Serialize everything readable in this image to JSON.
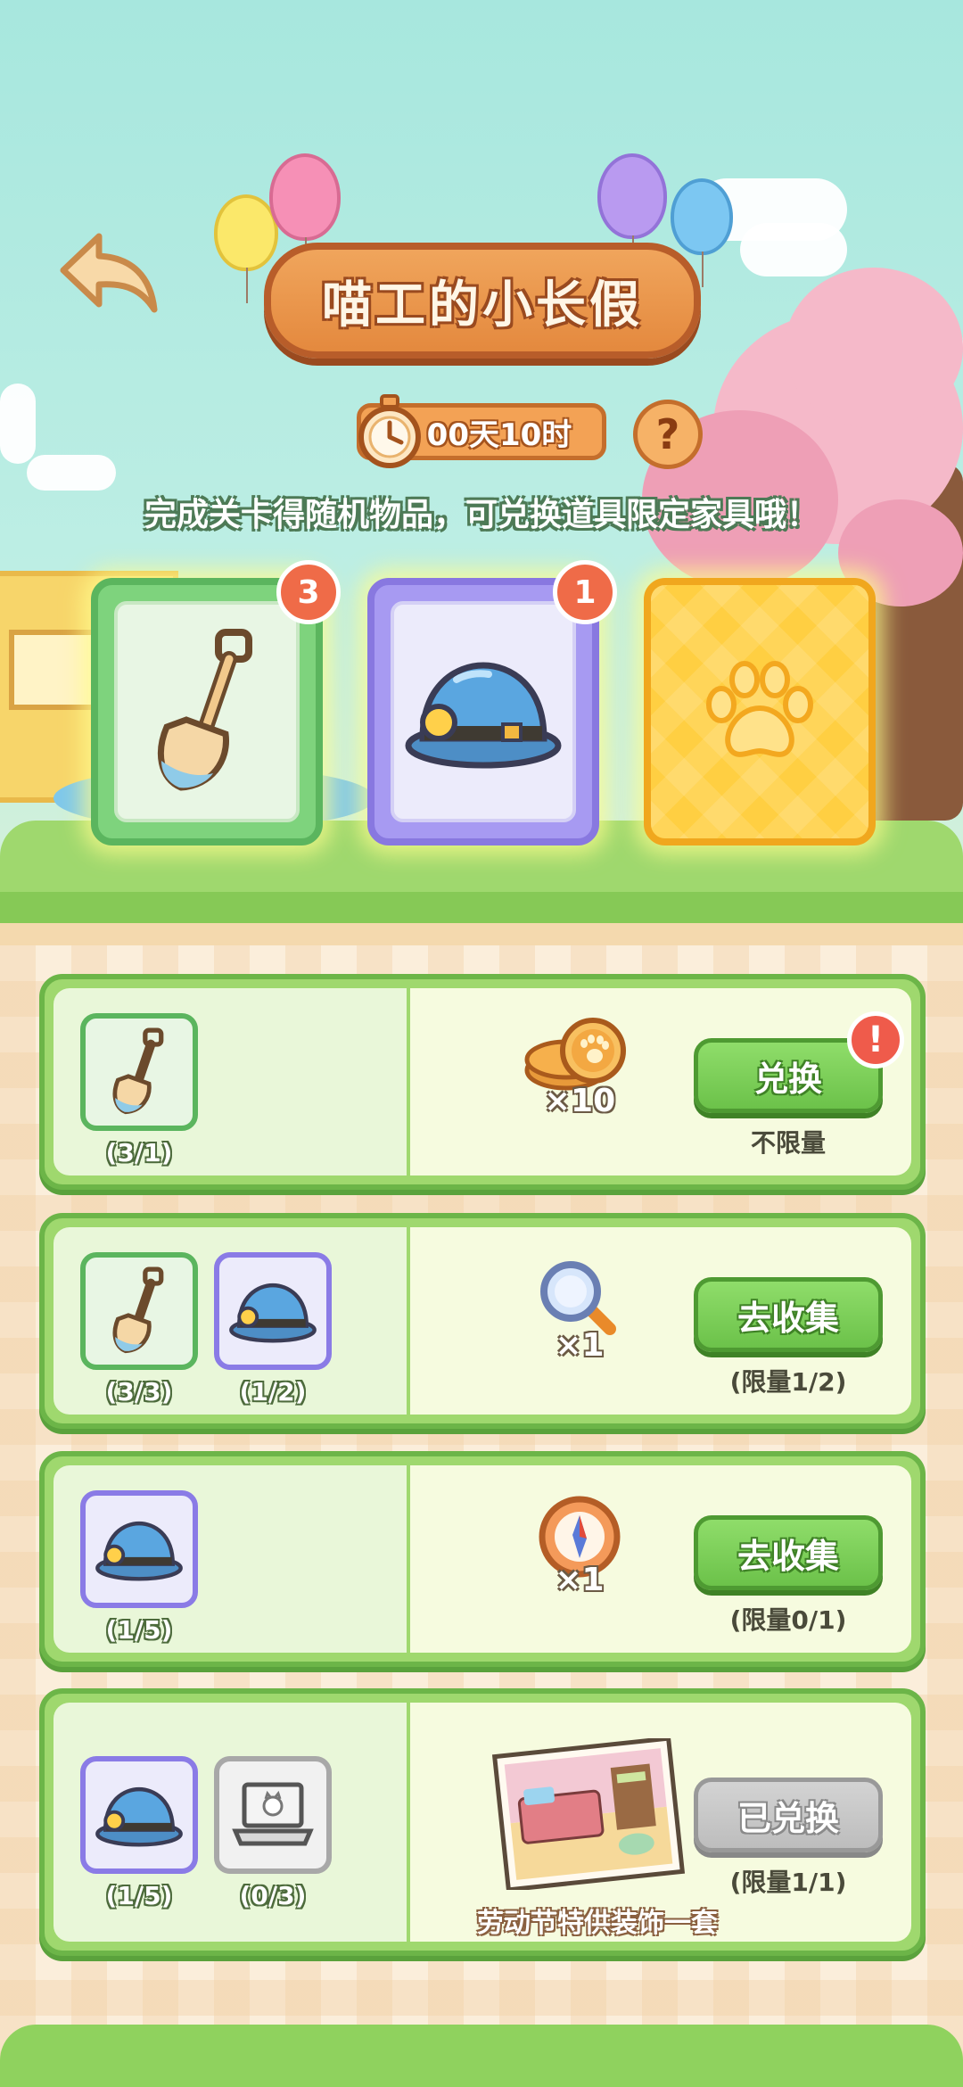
{
  "header": {
    "title": "喵工的小长假",
    "timer": "00天10时",
    "help": "?",
    "subtitle": "完成关卡得随机物品，可兑换道具限定家具哦！"
  },
  "cards": [
    {
      "name": "shovel-card",
      "icon": "shovel-icon",
      "badge": "3",
      "color": "#7ed37d"
    },
    {
      "name": "helmet-card",
      "icon": "mining-helmet-icon",
      "badge": "1",
      "color": "#a79af2"
    },
    {
      "name": "mystery-card",
      "icon": "paw-icon",
      "badge": "",
      "color": "#fcc63a"
    }
  ],
  "rows": [
    {
      "requirements": [
        {
          "icon": "shovel-icon",
          "count": "(3/1)"
        }
      ],
      "reward_icon": "coins-icon",
      "reward_qty": "×10",
      "button": "兑换",
      "limit": "不限量",
      "alert": "!"
    },
    {
      "requirements": [
        {
          "icon": "shovel-icon",
          "count": "(3/3)"
        },
        {
          "icon": "mining-helmet-icon",
          "count": "(1/2)"
        }
      ],
      "reward_icon": "magnifier-icon",
      "reward_qty": "×1",
      "button": "去收集",
      "limit": "(限量1/2)"
    },
    {
      "requirements": [
        {
          "icon": "mining-helmet-icon",
          "count": "(1/5)"
        }
      ],
      "reward_icon": "compass-icon",
      "reward_qty": "×1",
      "button": "去收集",
      "limit": "(限量0/1)"
    },
    {
      "requirements": [
        {
          "icon": "mining-helmet-icon",
          "count": "(1/5)"
        },
        {
          "icon": "laptop-icon",
          "count": "(0/3)"
        }
      ],
      "reward_icon": "room-decoration-icon",
      "reward_name": "劳动节特供装饰一套",
      "button": "已兑换",
      "limit": "(限量1/1)"
    }
  ],
  "colors": {
    "sky": "#a7e7de",
    "button_green": "#6cc24a",
    "button_gray": "#bdbdbd",
    "badge": "#ef6b48",
    "title_plate": "#e4893e"
  }
}
